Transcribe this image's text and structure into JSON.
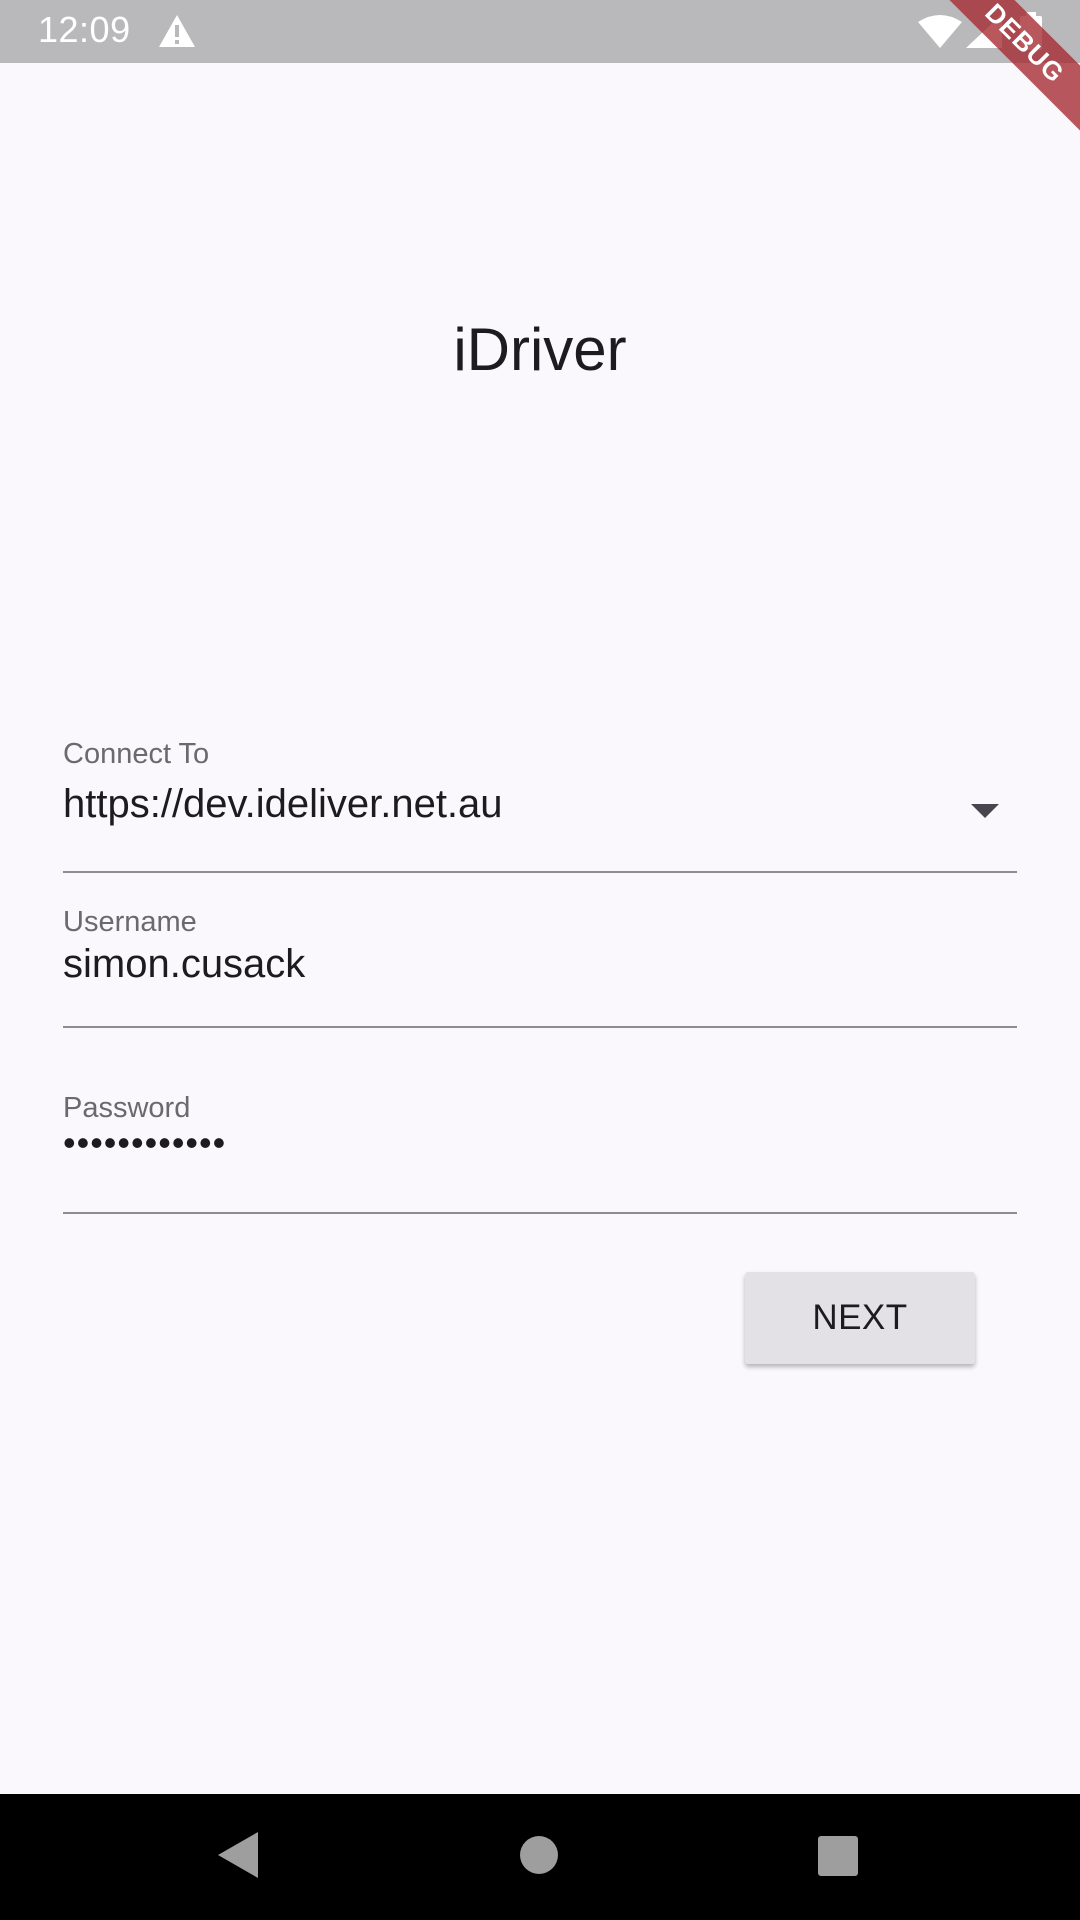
{
  "status_bar": {
    "time": "12:09",
    "icons": [
      "warning-icon",
      "wifi-icon",
      "signal-icon",
      "battery-icon"
    ]
  },
  "debug_banner": {
    "label": "DEBUG",
    "color": "#a42930"
  },
  "app": {
    "title": "iDriver"
  },
  "form": {
    "connect_to": {
      "label": "Connect To",
      "value": "https://dev.ideliver.net.au"
    },
    "username": {
      "label": "Username",
      "value": "simon.cusack"
    },
    "password": {
      "label": "Password",
      "value": "••••••••••••"
    },
    "next_label": "NEXT"
  },
  "nav_bar": {
    "icons": [
      "back-icon",
      "home-icon",
      "recents-icon"
    ]
  },
  "colors": {
    "background": "#faf8fc",
    "status_bar": "#b9b8bb",
    "button": "#e3e1e6",
    "underline": "#8e8c90"
  }
}
